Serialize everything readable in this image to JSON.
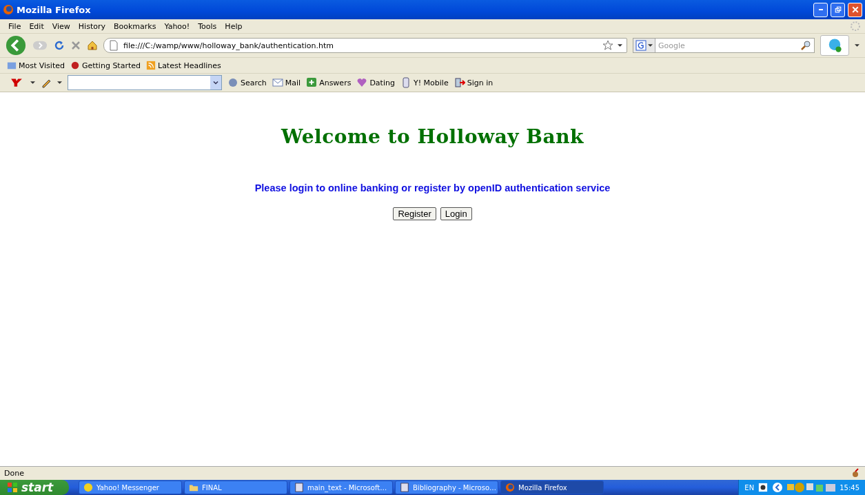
{
  "window": {
    "title": "Mozilla Firefox"
  },
  "menu": [
    "File",
    "Edit",
    "View",
    "History",
    "Bookmarks",
    "Yahoo!",
    "Tools",
    "Help"
  ],
  "navbar": {
    "url": "file:///C:/wamp/www/holloway_bank/authentication.htm",
    "search_placeholder": "Google"
  },
  "bookmarks": [
    "Most Visited",
    "Getting Started",
    "Latest Headlines"
  ],
  "yahoo_toolbar": {
    "items": [
      "Search",
      "Mail",
      "Answers",
      "Dating",
      "Y! Mobile",
      "Sign in"
    ]
  },
  "page": {
    "heading": "Welcome to Holloway Bank",
    "message": "Please login to online banking or register by openID authentication service",
    "buttons": [
      "Register",
      "Login"
    ]
  },
  "status_bar": {
    "text": "Done"
  },
  "taskbar": {
    "start": "start",
    "tasks": [
      {
        "label": "Yahoo! Messenger",
        "selected": false
      },
      {
        "label": "FINAL",
        "selected": false
      },
      {
        "label": "main_text - Microsoft…",
        "selected": false
      },
      {
        "label": "Bibliography - Microso…",
        "selected": false
      },
      {
        "label": "Mozilla Firefox",
        "selected": true
      }
    ],
    "language": "EN",
    "clock": "15:45"
  }
}
